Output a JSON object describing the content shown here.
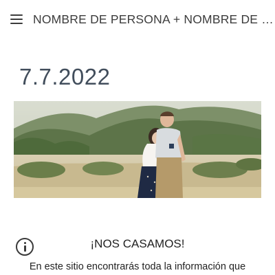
{
  "header": {
    "menu_icon": "hamburger-menu-icon",
    "site_title": "NOMBRE DE PERSONA + NOMBRE DE PERSONA"
  },
  "main": {
    "date": "7.7.2022",
    "hero_image": "couple-photo-in-field",
    "headline": "¡NOS CASAMOS!",
    "intro_text": "En este sitio encontrarás toda la información que"
  },
  "floating": {
    "info_icon": "info-icon"
  }
}
